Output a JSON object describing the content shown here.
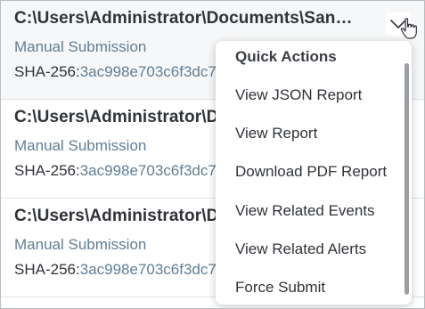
{
  "submissions": [
    {
      "path": "C:\\Users\\Administrator\\Documents\\Sandbox",
      "source": "Manual Submission",
      "sha_label": "SHA-256:",
      "sha_value": "3ac998e703c6f3dc7"
    },
    {
      "path": "C:\\Users\\Administrator\\Documents\\Sandbox",
      "source": "Manual Submission",
      "sha_label": "SHA-256:",
      "sha_value": "3ac998e703c6f3dc7"
    },
    {
      "path": "C:\\Users\\Administrator\\Documents\\Sandbox",
      "source": "Manual Submission",
      "sha_label": "SHA-256:",
      "sha_value": "3ac998e703c6f3dc7"
    }
  ],
  "menu": {
    "header": "Quick Actions",
    "items": [
      "View JSON Report",
      "View Report",
      "Download PDF Report",
      "View Related Events",
      "View Related Alerts",
      "Force Submit"
    ]
  },
  "icons": {
    "toggle": "chevron-down-icon",
    "cursor": "hand-pointer-icon"
  },
  "colors": {
    "path_text": "#2f3338",
    "secondary_text": "#5f7e96",
    "row_highlight": "#f6f7f8"
  }
}
